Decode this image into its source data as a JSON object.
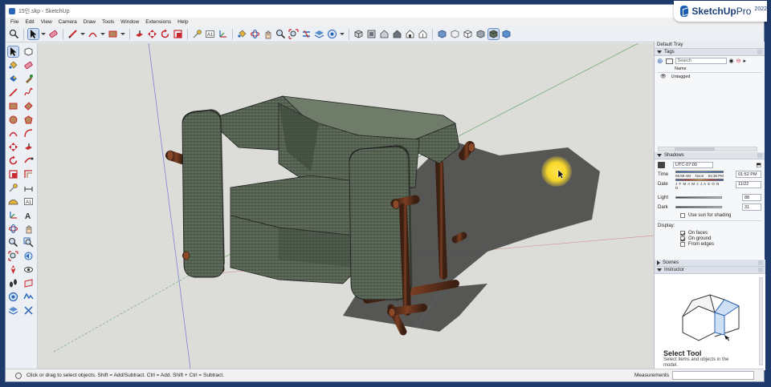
{
  "window": {
    "title": "15인.skp - SketchUp"
  },
  "brand": {
    "name": "SketchUp",
    "edition": "Pro",
    "year": "2022"
  },
  "menu": [
    "File",
    "Edit",
    "View",
    "Camera",
    "Draw",
    "Tools",
    "Window",
    "Extensions",
    "Help"
  ],
  "toolbar": {
    "icons": [
      "search-icon",
      "select-icon",
      "eraser-icon",
      "pencil-icon",
      "arc-icon",
      "rectangle-icon",
      "push-pull-icon",
      "move-icon",
      "rotate-icon",
      "scale-icon",
      "tape-measure-icon",
      "text-icon",
      "axes-icon",
      "paint-bucket-icon",
      "orbit-icon",
      "pan-icon",
      "zoom-icon",
      "zoom-extents-icon",
      "section-icon",
      "layers-icon",
      "styles-icon",
      "iso-view-icon",
      "top-view-icon",
      "front-view-icon",
      "right-view-icon",
      "back-view-icon",
      "left-view-icon",
      "xray-icon",
      "wireframe-icon",
      "hidden-line-icon",
      "shaded-icon",
      "shaded-textures-icon",
      "monochrome-icon"
    ],
    "colors": {
      "accent": "#2a66b8",
      "red": "#c8282e",
      "green": "#2f8a3a"
    }
  },
  "tray": {
    "title": "Default Tray",
    "tags": {
      "title": "Tags",
      "search_placeholder": "Search",
      "column_name": "Name",
      "rows": [
        {
          "name": "Untagged",
          "visible": true
        }
      ]
    },
    "shadows": {
      "title": "Shadows",
      "timezone": "UTC-07:00",
      "time_label": "Time",
      "time_start": "06:59 AM",
      "time_noon": "Noon",
      "time_end": "04:36 PM",
      "time_value": "01:52 PM",
      "date_label": "Date",
      "months": "J F M A M J J A S O N D",
      "date_value": "11/22",
      "light_label": "Light",
      "light_value": "88",
      "dark_label": "Dark",
      "dark_value": "31",
      "use_sun_label": "Use sun for shading",
      "use_sun": false,
      "display_label": "Display:",
      "on_faces_label": "On faces",
      "on_faces": true,
      "on_ground_label": "On ground",
      "on_ground": true,
      "from_edges_label": "From edges",
      "from_edges": false
    },
    "scenes": {
      "title": "Scenes"
    },
    "instructor": {
      "title": "Instructor",
      "tool_title": "Select Tool",
      "tool_desc": "Select items and objects in the model."
    }
  },
  "status": {
    "hint": "Click or drag to select objects. Shift = Add/Subtract. Ctrl = Add. Shift + Ctrl = Subtract.",
    "measurements_label": "Measurements",
    "measurements_value": ""
  }
}
